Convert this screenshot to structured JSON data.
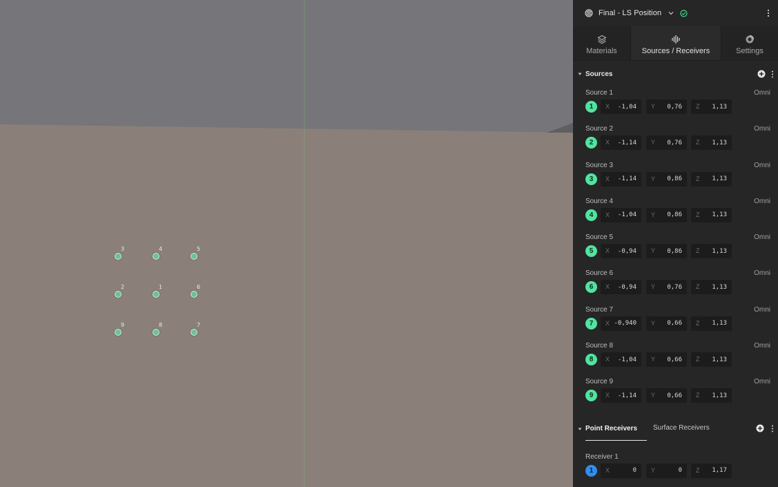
{
  "project": {
    "name": "Final - LS Position",
    "icons": {
      "project": "cube-icon",
      "dropdown": "chevron-down-icon",
      "status": "check-circle-icon",
      "menu": "kebab-icon"
    }
  },
  "tabs": [
    {
      "label": "Materials",
      "icon": "layers-icon"
    },
    {
      "label": "Sources / Receivers",
      "icon": "waveform-icon"
    },
    {
      "label": "Settings",
      "icon": "settings-icon"
    }
  ],
  "sources_section": {
    "title": "Sources",
    "items": [
      {
        "name": "Source 1",
        "type": "Omni",
        "badge": "1",
        "x": "-1,04",
        "y": "0,76",
        "z": "1,13"
      },
      {
        "name": "Source 2",
        "type": "Omni",
        "badge": "2",
        "x": "-1,14",
        "y": "0,76",
        "z": "1,13"
      },
      {
        "name": "Source 3",
        "type": "Omni",
        "badge": "3",
        "x": "-1,14",
        "y": "0,86",
        "z": "1,13"
      },
      {
        "name": "Source 4",
        "type": "Omni",
        "badge": "4",
        "x": "-1,04",
        "y": "0,86",
        "z": "1,13"
      },
      {
        "name": "Source 5",
        "type": "Omni",
        "badge": "5",
        "x": "-0,94",
        "y": "0,86",
        "z": "1,13"
      },
      {
        "name": "Source 6",
        "type": "Omni",
        "badge": "6",
        "x": "-0,94",
        "y": "0,76",
        "z": "1,13"
      },
      {
        "name": "Source 7",
        "type": "Omni",
        "badge": "7",
        "x": "-0,940",
        "y": "0,66",
        "z": "1,13"
      },
      {
        "name": "Source 8",
        "type": "Omni",
        "badge": "8",
        "x": "-1,04",
        "y": "0,66",
        "z": "1,13"
      },
      {
        "name": "Source 9",
        "type": "Omni",
        "badge": "9",
        "x": "-1,14",
        "y": "0,66",
        "z": "1,13"
      }
    ]
  },
  "receivers_section": {
    "tabs": [
      "Point Receivers",
      "Surface Receivers"
    ],
    "items": [
      {
        "name": "Receiver 1",
        "badge": "1",
        "x": "0",
        "y": "0",
        "z": "1,17"
      }
    ]
  },
  "axis_labels": {
    "x": "X",
    "y": "Y",
    "z": "Z"
  },
  "viewport": {
    "markers": [
      {
        "label": "3"
      },
      {
        "label": "4"
      },
      {
        "label": "5"
      },
      {
        "label": "2"
      },
      {
        "label": "1"
      },
      {
        "label": "6"
      },
      {
        "label": "9"
      },
      {
        "label": "8"
      },
      {
        "label": "7"
      }
    ]
  },
  "colors": {
    "source_badge": "#52e3a0",
    "receiver_badge": "#2e8ff0",
    "panel_bg": "#262626",
    "ceiling": "#75757a",
    "wall": "#8a8079"
  }
}
